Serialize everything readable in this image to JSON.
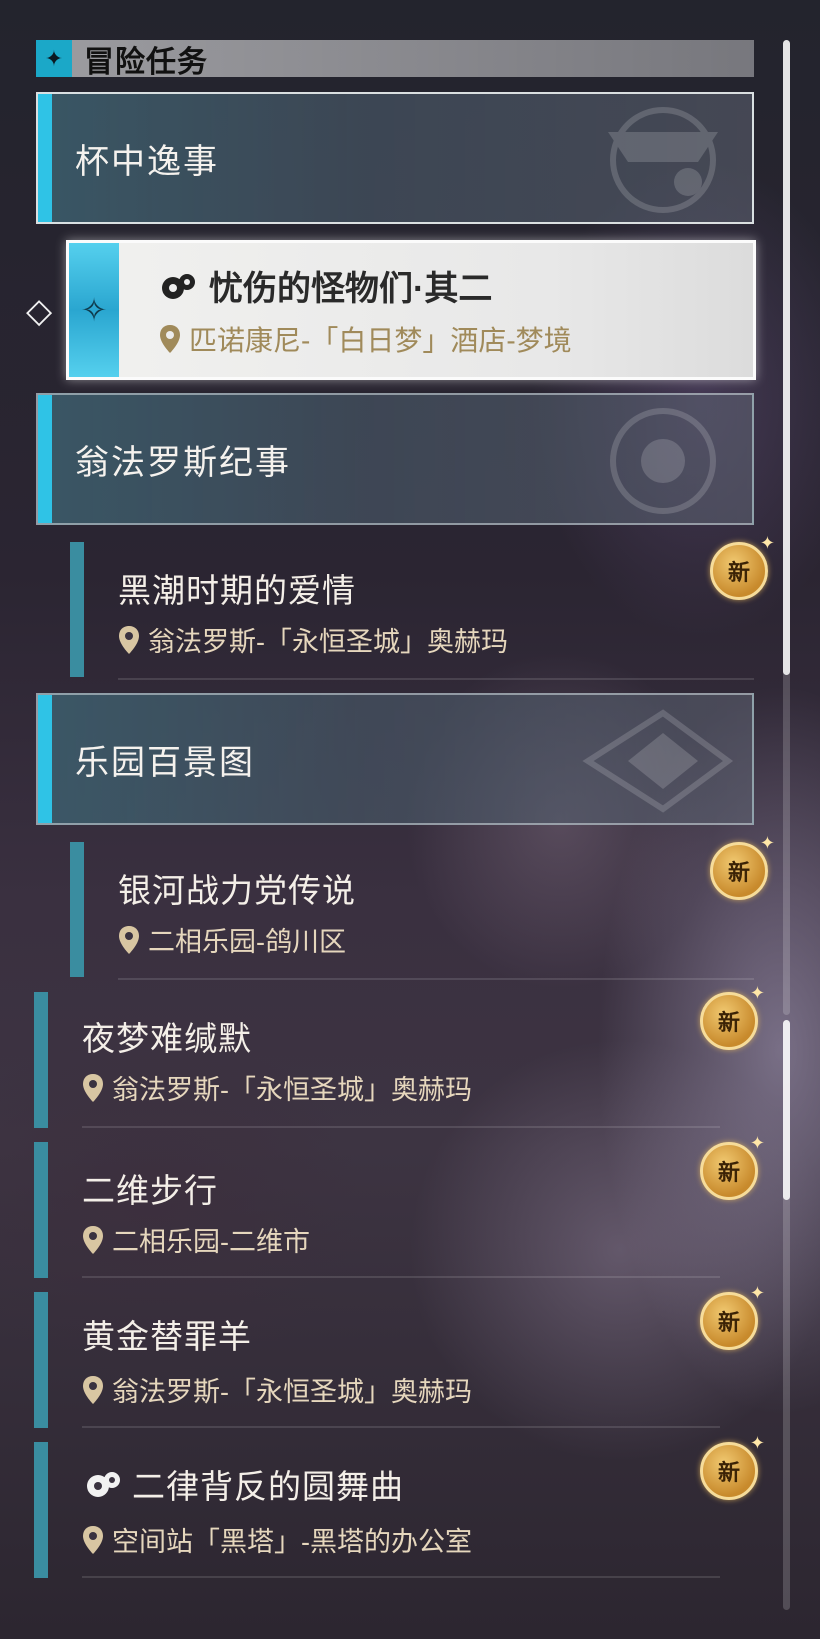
{
  "header": {
    "title": "冒险任务",
    "icon": "sparkle-icon"
  },
  "categories": [
    {
      "title": "杯中逸事"
    },
    {
      "title": "翁法罗斯纪事"
    },
    {
      "title": "乐园百景图"
    }
  ],
  "selected_quest": {
    "title": "忧伤的怪物们·其二",
    "location": "匹诺康尼-「白日梦」酒店-梦境"
  },
  "quests": [
    {
      "title": "黑潮时期的爱情",
      "location": "翁法罗斯-「永恒圣城」奥赫玛",
      "badge": "新"
    },
    {
      "title": "银河战力党传说",
      "location": "二相乐园-鸽川区",
      "badge": "新"
    },
    {
      "title": "夜梦难缄默",
      "location": "翁法罗斯-「永恒圣城」奥赫玛",
      "badge": "新"
    },
    {
      "title": "二维步行",
      "location": "二相乐园-二维市",
      "badge": "新"
    },
    {
      "title": "黄金替罪羊",
      "location": "翁法罗斯-「永恒圣城」奥赫玛",
      "badge": "新"
    },
    {
      "title": "二律背反的圆舞曲",
      "location": "空间站「黑塔」-黑塔的办公室",
      "badge": "新"
    }
  ],
  "colors": {
    "accent": "#2fc3e6",
    "quest_bar": "#3a8da0",
    "location_text": "#e6d7bd",
    "badge": "#d9a140"
  }
}
